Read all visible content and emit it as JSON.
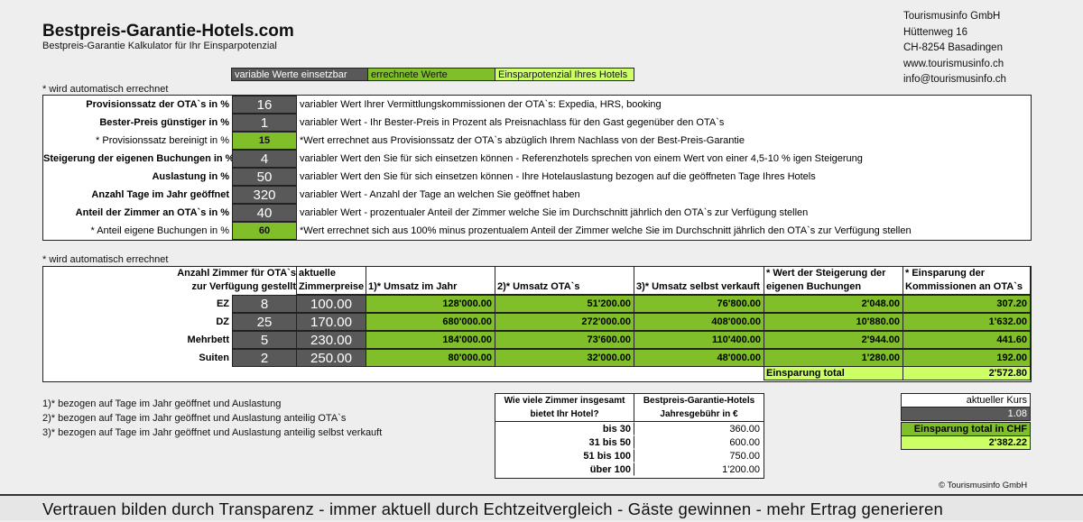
{
  "header": {
    "title": "Bestpreis-Garantie-Hotels.com",
    "subtitle": "Bestpreis-Garantie Kalkulator für Ihr Einsparpotenzial"
  },
  "company": {
    "name": "Tourismusinfo GmbH",
    "street": "Hüttenweg 16",
    "city": "CH-8254 Basadingen",
    "web": "www.tourismusinfo.ch",
    "email": "info@tourismusinfo.ch"
  },
  "legend": {
    "variable": "variable Werte einsetzbar",
    "computed": "errechnete Werte",
    "potential": "Einsparpotenzial Ihres Hotels"
  },
  "notes": {
    "auto1": "* wird automatisch errechnet",
    "auto2": "* wird automatisch errechnet"
  },
  "params": [
    {
      "label": "Provisionssatz der OTA`s in %",
      "value": "16",
      "kind": "var",
      "desc": "variabler Wert Ihrer Vermittlungskommissionen der OTA`s: Expedia, HRS, booking",
      "bold": true
    },
    {
      "label": "Bester-Preis günstiger in %",
      "value": "1",
      "kind": "var",
      "desc": "variabler Wert - Ihr Bester-Preis in Prozent als Preisnachlass für den Gast  gegenüber den OTA`s",
      "bold": true
    },
    {
      "label": "* Provisionssatz bereinigt in %",
      "value": "15",
      "kind": "calc",
      "desc": "*Wert errechnet aus Provisionssatz der OTA`s abzüglich Ihrem Nachlass von der  Best-Preis-Garantie",
      "bold": false
    },
    {
      "label": "Steigerung der eigenen Buchungen in %",
      "value": "4",
      "kind": "var",
      "desc": "variabler Wert den Sie für sich einsetzen können - Referenzhotels sprechen von einem Wert von einer 4,5-10 % igen Steigerung",
      "bold": true
    },
    {
      "label": "Auslastung in %",
      "value": "50",
      "kind": "var",
      "desc": "variabler Wert den Sie für sich einsetzen können - Ihre Hotelauslastung bezogen auf die geöffneten Tage Ihres Hotels",
      "bold": true
    },
    {
      "label": "Anzahl Tage im Jahr geöffnet",
      "value": "320",
      "kind": "var",
      "desc": "variabler Wert - Anzahl der Tage an welchen Sie geöffnet haben",
      "bold": true
    },
    {
      "label": "Anteil der Zimmer an OTA`s in %",
      "value": "40",
      "kind": "var",
      "desc": "variabler Wert - prozentualer Anteil der Zimmer welche Sie im Durchschnitt jährlich den OTA`s zur Verfügung stellen",
      "bold": true
    },
    {
      "label": "* Anteil eigene Buchungen in %",
      "value": "60",
      "kind": "calc",
      "desc": "*Wert errechnet sich aus 100% minus prozentualem Anteil der Zimmer welche Sie im Durchschnitt jährlich den OTA`s zur Verfügung stellen",
      "bold": false
    }
  ],
  "rooms_table": {
    "headers": {
      "rooms": "Anzahl Zimmer für OTA`s",
      "rooms2": "zur Verfügung gestellt",
      "price": "aktuelle",
      "price2": "Zimmerpreise",
      "umsatz": "1)* Umsatz im Jahr",
      "ota": "2)* Umsatz OTA`s",
      "self": "3)* Umsatz selbst verkauft",
      "increase": "* Wert der Steigerung der",
      "increase2": "eigenen Buchungen",
      "saving": "* Einsparung der",
      "saving2": "Kommissionen an OTA`s"
    },
    "rows": [
      {
        "type": "EZ",
        "rooms": "8",
        "price": "100.00",
        "umsatz": "128'000.00",
        "ota": "51'200.00",
        "self": "76'800.00",
        "increase": "2'048.00",
        "saving": "307.20"
      },
      {
        "type": "DZ",
        "rooms": "25",
        "price": "170.00",
        "umsatz": "680'000.00",
        "ota": "272'000.00",
        "self": "408'000.00",
        "increase": "10'880.00",
        "saving": "1'632.00"
      },
      {
        "type": "Mehrbett",
        "rooms": "5",
        "price": "230.00",
        "umsatz": "184'000.00",
        "ota": "73'600.00",
        "self": "110'400.00",
        "increase": "2'944.00",
        "saving": "441.60"
      },
      {
        "type": "Suiten",
        "rooms": "2",
        "price": "250.00",
        "umsatz": "80'000.00",
        "ota": "32'000.00",
        "self": "48'000.00",
        "increase": "1'280.00",
        "saving": "192.00"
      }
    ],
    "total_label": "Einsparung total",
    "total_value": "2'572.80"
  },
  "footnotes": [
    "1)* bezogen auf Tage im Jahr geöffnet und Auslastung",
    "2)* bezogen auf Tage im Jahr geöffnet und Auslastung anteilig OTA`s",
    "3)* bezogen auf Tage im Jahr geöffnet und Auslastung anteilig selbst verkauft"
  ],
  "fee_table": {
    "h1": "Wie viele Zimmer insgesamt",
    "h1b": "bietet Ihr Hotel?",
    "h2": "Bestpreis-Garantie-Hotels",
    "h2b": "Jahresgebühr in €",
    "rows": [
      {
        "range": "bis 30",
        "fee": "360.00"
      },
      {
        "range": "31 bis 50",
        "fee": "600.00"
      },
      {
        "range": "51 bis 100",
        "fee": "750.00"
      },
      {
        "range": "über 100",
        "fee": "1'200.00"
      }
    ]
  },
  "chf": {
    "label": "aktueller Kurs",
    "rate": "1.08",
    "total_label": "Einsparung total in CHF",
    "total_value": "2'382.22"
  },
  "copyright": "© Tourismusinfo GmbH",
  "footer": "Vertrauen bilden durch Transparenz  -  immer aktuell durch Echtzeitvergleich  -  Gäste gewinnen  -  mehr Ertrag generieren",
  "colors": {
    "green": "#80be2a",
    "lime": "#ccff66",
    "gray": "#595959"
  }
}
